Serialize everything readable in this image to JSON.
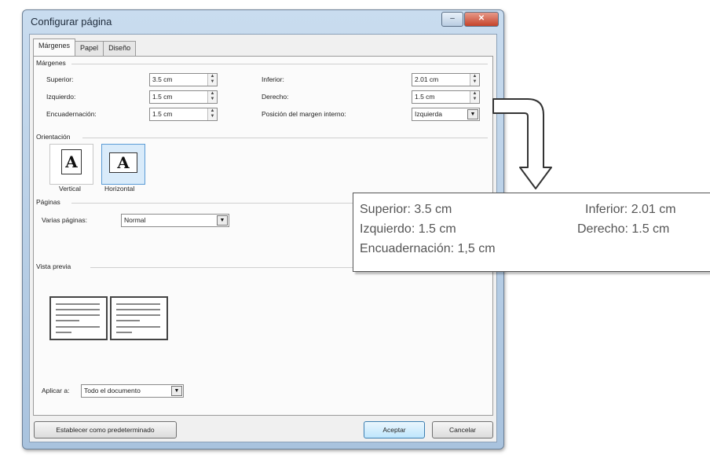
{
  "window": {
    "title": "Configurar página",
    "minimize": "–",
    "maximize": "□",
    "close": "✕"
  },
  "tabs": [
    "Márgenes",
    "Papel",
    "Diseño"
  ],
  "margenes": {
    "section": "Márgenes",
    "superior": {
      "label": "Superior:",
      "value": "3.5 cm"
    },
    "inferior": {
      "label": "Inferior:",
      "value": "2.01 cm"
    },
    "izquierdo": {
      "label": "Izquierdo:",
      "value": "1.5 cm"
    },
    "derecho": {
      "label": "Derecho:",
      "value": "1.5 cm"
    },
    "encuadernacion": {
      "label": "Encuadernación:",
      "value": "1.5 cm"
    },
    "posicion": {
      "label": "Posición del margen interno:",
      "value": "Izquierda"
    }
  },
  "orientacion": {
    "section": "Orientación",
    "vertical": "Vertical",
    "horizontal": "Horizontal",
    "icon_letter": "A"
  },
  "paginas": {
    "section": "Páginas",
    "label": "Varias páginas:",
    "value": "Normal"
  },
  "vista_previa": {
    "section": "Vista previa"
  },
  "aplicar": {
    "label": "Aplicar a:",
    "value": "Todo el documento"
  },
  "buttons": {
    "default": "Establecer como predeterminado",
    "ok": "Aceptar",
    "cancel": "Cancelar"
  },
  "callout": {
    "superior": "Superior: 3.5 cm",
    "izquierdo": "Izquierdo: 1.5 cm",
    "encuadernacion": "Encuadernación: 1,5 cm",
    "inferior": "Inferior: 2.01 cm",
    "derecho": "Derecho: 1.5 cm"
  },
  "icons": {
    "spin": "spin-arrows-icon",
    "dropdown": "chevron-down-icon",
    "arrow": "curved-arrow-icon"
  }
}
